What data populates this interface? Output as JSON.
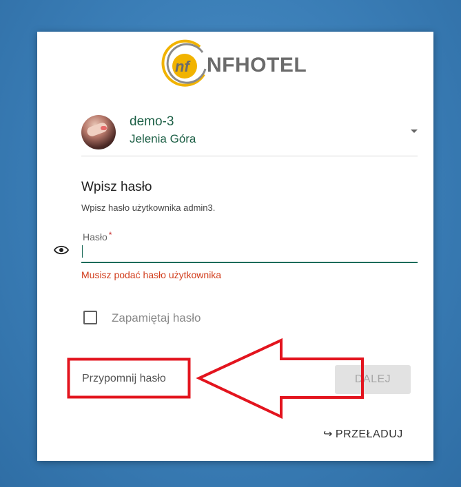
{
  "brand": {
    "logo_text": "NFHOTEL",
    "logo_mark": "nf"
  },
  "account": {
    "name": "demo-3",
    "location": "Jelenia Góra"
  },
  "password_step": {
    "title": "Wpisz hasło",
    "subtitle": "Wpisz hasło użytkownika admin3.",
    "field_label": "Hasło",
    "required_mark": "*",
    "value": "",
    "error": "Musisz podać hasło użytkownika"
  },
  "remember": {
    "label": "Zapamiętaj hasło",
    "checked": false
  },
  "actions": {
    "remind_label": "Przypomnij hasło",
    "next_label": "DALEJ",
    "reload_label": "PRZEŁADUJ"
  },
  "colors": {
    "accent": "#1c6c5a",
    "error": "#d13b1a",
    "annotation": "#e3141e",
    "background": "#3a7db6"
  },
  "icons": [
    "eye-icon",
    "dropdown-caret-icon",
    "reload-arrow-icon"
  ]
}
